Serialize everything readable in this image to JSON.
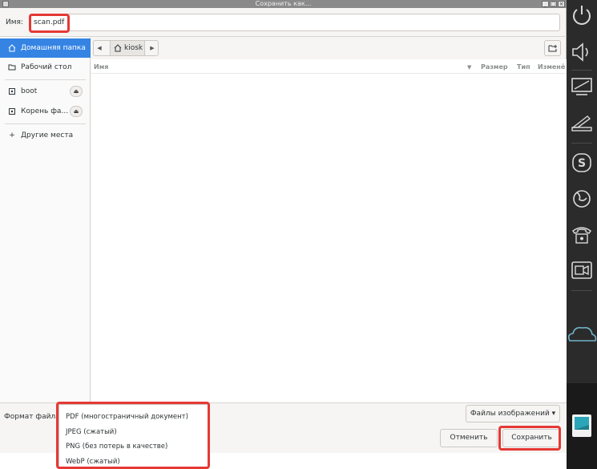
{
  "window": {
    "title": "Сохранить как...",
    "buttons": [
      "_",
      "□",
      "×"
    ]
  },
  "name_field": {
    "label": "Имя:",
    "value": "scan.pdf"
  },
  "sidebar": {
    "items": [
      {
        "label": "Домашняя папка",
        "icon": "home-icon"
      },
      {
        "label": "Рабочий стол",
        "icon": "folder-icon"
      },
      {
        "label": "boot",
        "icon": "drive-icon"
      },
      {
        "label": "Корень фа…",
        "icon": "drive-icon"
      },
      {
        "label": "Другие места",
        "icon": "plus-icon"
      }
    ],
    "eject_glyph": "⏏"
  },
  "pathbar": {
    "current": "kiosk"
  },
  "columns": {
    "name": "Имя",
    "size": "Размер",
    "type": "Тип",
    "modified": "Изменё"
  },
  "bottom": {
    "format_label": "Формат файла",
    "filter_button": "Файлы изображений ▾",
    "cancel_button": "Отменить",
    "save_button": "Сохранить"
  },
  "format_options": [
    "PDF (многостраничный документ)",
    "JPEG (сжатый)",
    "PNG (без потерь в качестве)",
    "WebP (сжатый)"
  ],
  "colors": {
    "accent": "#3584e4",
    "highlight": "#e53935",
    "dock": "#2b2b2b"
  },
  "dock_icons": [
    "power-icon",
    "volume-icon",
    "display-icon",
    "scanner-icon",
    "skype-icon",
    "firefox-icon",
    "phone-icon",
    "video-icon",
    "cloud-icon",
    "app-icon"
  ]
}
